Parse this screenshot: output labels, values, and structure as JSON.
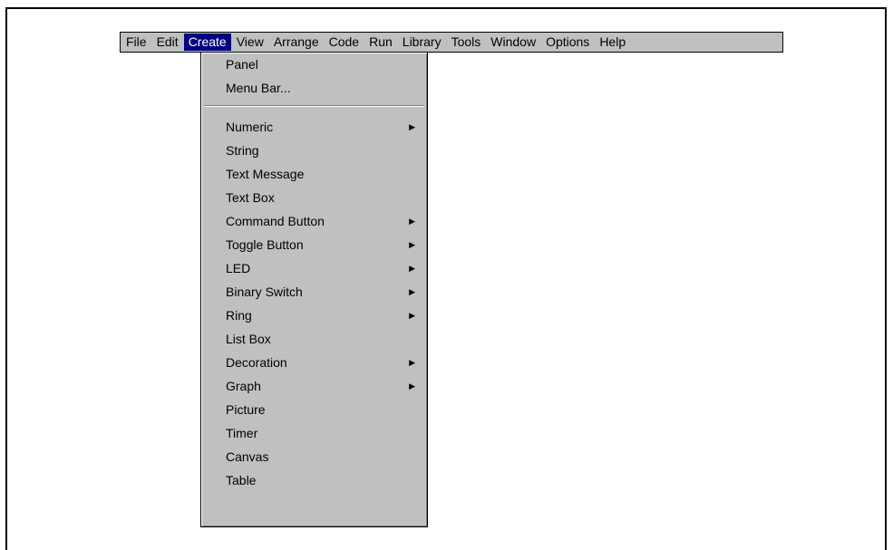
{
  "menubar": {
    "items": [
      {
        "label": "File"
      },
      {
        "label": "Edit"
      },
      {
        "label": "Create"
      },
      {
        "label": "View"
      },
      {
        "label": "Arrange"
      },
      {
        "label": "Code"
      },
      {
        "label": "Run"
      },
      {
        "label": "Library"
      },
      {
        "label": "Tools"
      },
      {
        "label": "Window"
      },
      {
        "label": "Options"
      },
      {
        "label": "Help"
      }
    ]
  },
  "create_menu": {
    "top_items": [
      {
        "label": "Panel"
      },
      {
        "label": "Menu Bar..."
      }
    ],
    "items": [
      {
        "label": "Numeric",
        "submenu": true
      },
      {
        "label": "String",
        "submenu": false
      },
      {
        "label": "Text Message",
        "submenu": false
      },
      {
        "label": "Text Box",
        "submenu": false
      },
      {
        "label": "Command Button",
        "submenu": true
      },
      {
        "label": "Toggle Button",
        "submenu": true
      },
      {
        "label": "LED",
        "submenu": true
      },
      {
        "label": "Binary Switch",
        "submenu": true
      },
      {
        "label": "Ring",
        "submenu": true
      },
      {
        "label": "List Box",
        "submenu": false
      },
      {
        "label": "Decoration",
        "submenu": true
      },
      {
        "label": "Graph",
        "submenu": true
      },
      {
        "label": "Picture",
        "submenu": false
      },
      {
        "label": "Timer",
        "submenu": false
      },
      {
        "label": "Canvas",
        "submenu": false
      },
      {
        "label": "Table",
        "submenu": false
      }
    ]
  },
  "icons": {
    "submenu": "triangle-right-icon"
  },
  "colors": {
    "menu_bg": "#c0c0c0",
    "highlight": "#000080"
  }
}
